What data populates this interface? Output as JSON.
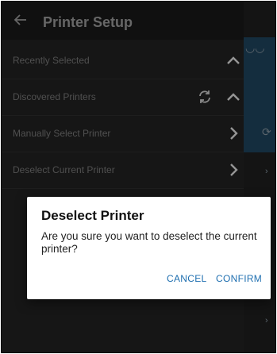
{
  "header": {
    "title": "Printer Setup",
    "back_icon": "arrow-left-icon"
  },
  "sections": [
    {
      "label": "Recently Selected",
      "icons": [
        "chevron-up-icon"
      ]
    },
    {
      "label": "Discovered Printers",
      "icons": [
        "refresh-icon",
        "chevron-up-icon"
      ]
    },
    {
      "label": "Manually Select Printer",
      "icons": [
        "chevron-right-icon"
      ]
    },
    {
      "label": "Deselect Current Printer",
      "icons": [
        "chevron-right-icon"
      ]
    }
  ],
  "dialog": {
    "title": "Deselect Printer",
    "message": "Are you sure you want to deselect the current printer?",
    "cancel_label": "CANCEL",
    "confirm_label": "CONFIRM"
  },
  "colors": {
    "panel": "#1f1f1f",
    "header": "#171717",
    "accent": "#1f6fb0",
    "dialog": "#ffffff"
  }
}
